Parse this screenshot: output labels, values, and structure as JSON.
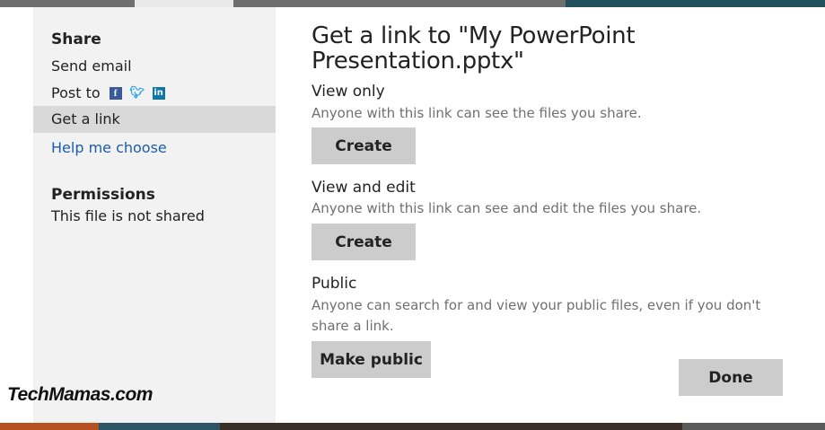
{
  "sidebar": {
    "share_heading": "Share",
    "items": [
      {
        "label": "Send email"
      },
      {
        "label": "Post to"
      },
      {
        "label": "Get a link"
      },
      {
        "label": "Help me choose"
      }
    ],
    "social_icons": [
      "facebook-icon",
      "twitter-icon",
      "linkedin-icon"
    ],
    "permissions_heading": "Permissions",
    "permissions_text": "This file is not shared"
  },
  "main": {
    "title": "Get a link to \"My PowerPoint Presentation.pptx\"",
    "sections": [
      {
        "label": "View only",
        "description": "Anyone with this link can see the files you share.",
        "button": "Create"
      },
      {
        "label": "View and edit",
        "description": "Anyone with this link can see and edit the files you share.",
        "button": "Create"
      },
      {
        "label": "Public",
        "description": "Anyone can search for and view your public files, even if you don't share a link.",
        "button": "Make public"
      }
    ],
    "done_button": "Done"
  },
  "watermark": "TechMamas.com",
  "colors": {
    "sidebar_bg": "#f2f2f2",
    "active_item_bg": "#d9d9d9",
    "link": "#1a5ea8",
    "button_bg": "#cccccc",
    "description": "#707070"
  }
}
